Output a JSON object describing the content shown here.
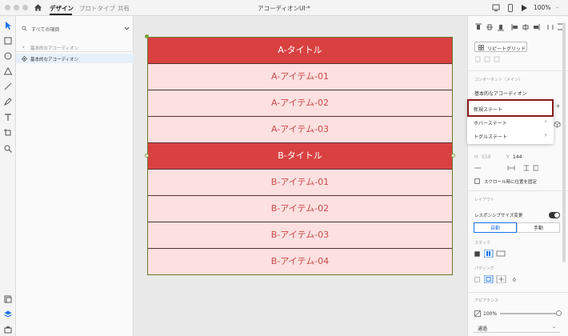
{
  "topbar": {
    "tabs": [
      {
        "label": "デザイン",
        "active": true
      },
      {
        "label": "プロトタイプ",
        "active": false
      },
      {
        "label": "共有",
        "active": false
      }
    ],
    "doc_title": "アコーディオンUI *",
    "zoom": "100%"
  },
  "layers": {
    "search_placeholder": "すべての項目",
    "breadcrumb": "基本的なアコーディオン",
    "selected_layer": "基本的なアコーディオン"
  },
  "accordion": {
    "rows": [
      {
        "label": "A-タイトル",
        "kind": "title"
      },
      {
        "label": "A-アイテム-01",
        "kind": "item"
      },
      {
        "label": "A-アイテム-02",
        "kind": "item"
      },
      {
        "label": "A-アイテム-03",
        "kind": "item"
      },
      {
        "label": "B-タイトル",
        "kind": "title"
      },
      {
        "label": "B-アイテム-01",
        "kind": "item"
      },
      {
        "label": "B-アイテム-02",
        "kind": "item"
      },
      {
        "label": "B-アイテム-03",
        "kind": "item"
      },
      {
        "label": "B-アイテム-04",
        "kind": "item"
      }
    ],
    "colors": {
      "title_bg": "#d94141",
      "item_bg": "#fde0e0",
      "item_text": "#c94b4b"
    }
  },
  "inspector": {
    "repeat_grid": "リピートグリッド",
    "component_label": "コンポーネント（メイン）",
    "component_name": "基本的なアコーディオン",
    "states": {
      "new_state": "新規ステート",
      "hover_state": "ホバーステート",
      "toggle_state": "トグルステート"
    },
    "h_label": "H",
    "h_value": "558",
    "y_label": "Y",
    "y_value": "144",
    "fix_scroll": "スクロール時に位置を固定",
    "layout_label": "レイアウト",
    "responsive": "レスポンシブサイズ変更",
    "auto": "自動",
    "manual": "手動",
    "stack_label": "スタック",
    "padding_label": "パディング",
    "padding_value": "0",
    "appearance_label": "アピアランス",
    "opacity": "100%",
    "blend": "通過"
  }
}
